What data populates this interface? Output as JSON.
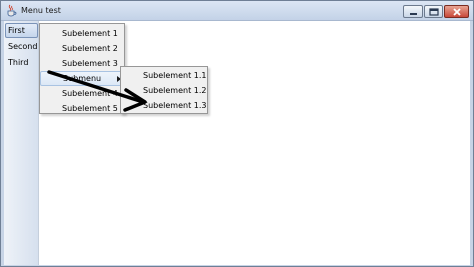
{
  "window": {
    "title": "Menu test",
    "icon": "java-cup-icon",
    "buttons": [
      "minimize-icon",
      "maximize-icon",
      "close-icon"
    ]
  },
  "menubar": {
    "items": [
      {
        "label": "First",
        "selected": true
      },
      {
        "label": "Second",
        "selected": false
      },
      {
        "label": "Third",
        "selected": false
      }
    ]
  },
  "popup_menu": {
    "items": [
      {
        "label": "Subelement 1"
      },
      {
        "label": "Subelement 2"
      },
      {
        "label": "Subelement 3"
      },
      {
        "label": "Submenu",
        "has_submenu": true,
        "highlighted": true
      },
      {
        "label": "Subelement 4"
      },
      {
        "label": "Subelement 5"
      }
    ]
  },
  "submenu": {
    "items": [
      {
        "label": "Subelement 1.1"
      },
      {
        "label": "Subelement 1.2"
      },
      {
        "label": "Subelement 1.3"
      }
    ]
  },
  "annotation": {
    "type": "arrow",
    "color": "#000000"
  }
}
